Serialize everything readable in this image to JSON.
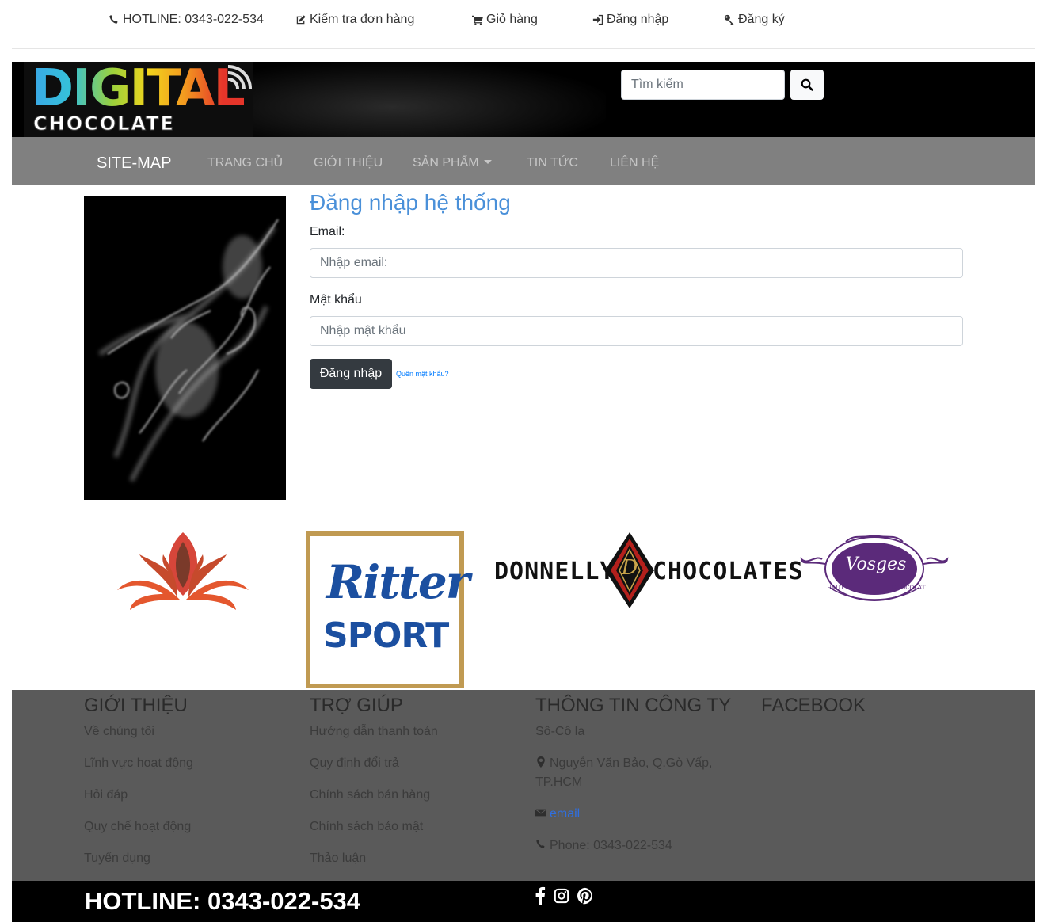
{
  "topbar": {
    "hotline": "HOTLINE: 0343-022-534",
    "check_order": "Kiểm tra đơn hàng",
    "cart": "Giỏ hàng",
    "login": "Đăng nhập",
    "register": "Đăng ký"
  },
  "logo": {
    "line1": "DIGITAL",
    "line2": "CHOCOLATE"
  },
  "search": {
    "placeholder": "Tìm kiếm"
  },
  "nav": {
    "brand": "SITE-MAP",
    "items": [
      {
        "label": "TRANG CHỦ"
      },
      {
        "label": "GIỚI THIỆU"
      },
      {
        "label": "SẢN PHẨM"
      },
      {
        "label": "TIN TỨC"
      },
      {
        "label": "LIÊN HỆ"
      }
    ]
  },
  "login_form": {
    "title": "Đăng nhập hệ thống",
    "email_label": "Email:",
    "email_placeholder": "Nhập email:",
    "password_label": "Mật khẩu",
    "password_placeholder": "Nhập mật khẩu",
    "submit_label": "Đăng nhập",
    "forgot_label": "Quên mật khẩu?"
  },
  "brands": {
    "ritter_line1": "Ritter",
    "ritter_line2": "SPORT",
    "donnelly_left": "DONNELLY",
    "donnelly_right": "CHOCOLATES",
    "donnelly_mark": "D",
    "vosges_name": "Vosges",
    "vosges_left": "HAUT",
    "vosges_right": "CHOCOLAT"
  },
  "footer": {
    "about": {
      "heading": "GIỚI THIỆU",
      "links": [
        "Về chúng tôi",
        "Lĩnh vực hoạt động",
        "Hỏi đáp",
        "Quy chế hoạt động",
        "Tuyển dụng"
      ]
    },
    "help": {
      "heading": "TRỢ GIÚP",
      "links": [
        "Hướng dẫn thanh toán",
        "Quy định đổi trả",
        "Chính sách bán hàng",
        "Chính sách bảo mật",
        "Thảo luận"
      ]
    },
    "company": {
      "heading": "THÔNG TIN CÔNG TY",
      "name": "Sô-Cô la",
      "address_line1": "Nguyễn Văn Bảo, Q.Gò Vấp,",
      "address_line2": "TP.HCM",
      "email_link": "email",
      "phone": "Phone: 0343-022-534"
    },
    "facebook": {
      "heading": "FACEBOOK"
    },
    "hotline": "HOTLINE: 0343-022-534"
  },
  "colors": {
    "title_blue": "#4a90d9",
    "nav_bg": "#808080",
    "footer_bg": "#5a5a5a",
    "ritter_blue": "#1b4fa0",
    "ritter_gold": "#c09a52",
    "vosges_purple": "#5b2a7a"
  },
  "icons": {
    "hotline": "phone-icon",
    "check_order": "edit-icon",
    "cart": "cart-icon",
    "login": "sign-in-icon",
    "register": "key-icon",
    "search": "search-icon",
    "address": "map-marker-icon",
    "email": "envelope-icon",
    "phone": "phone-icon",
    "social": [
      "facebook-icon",
      "instagram-icon",
      "pinterest-icon"
    ]
  }
}
